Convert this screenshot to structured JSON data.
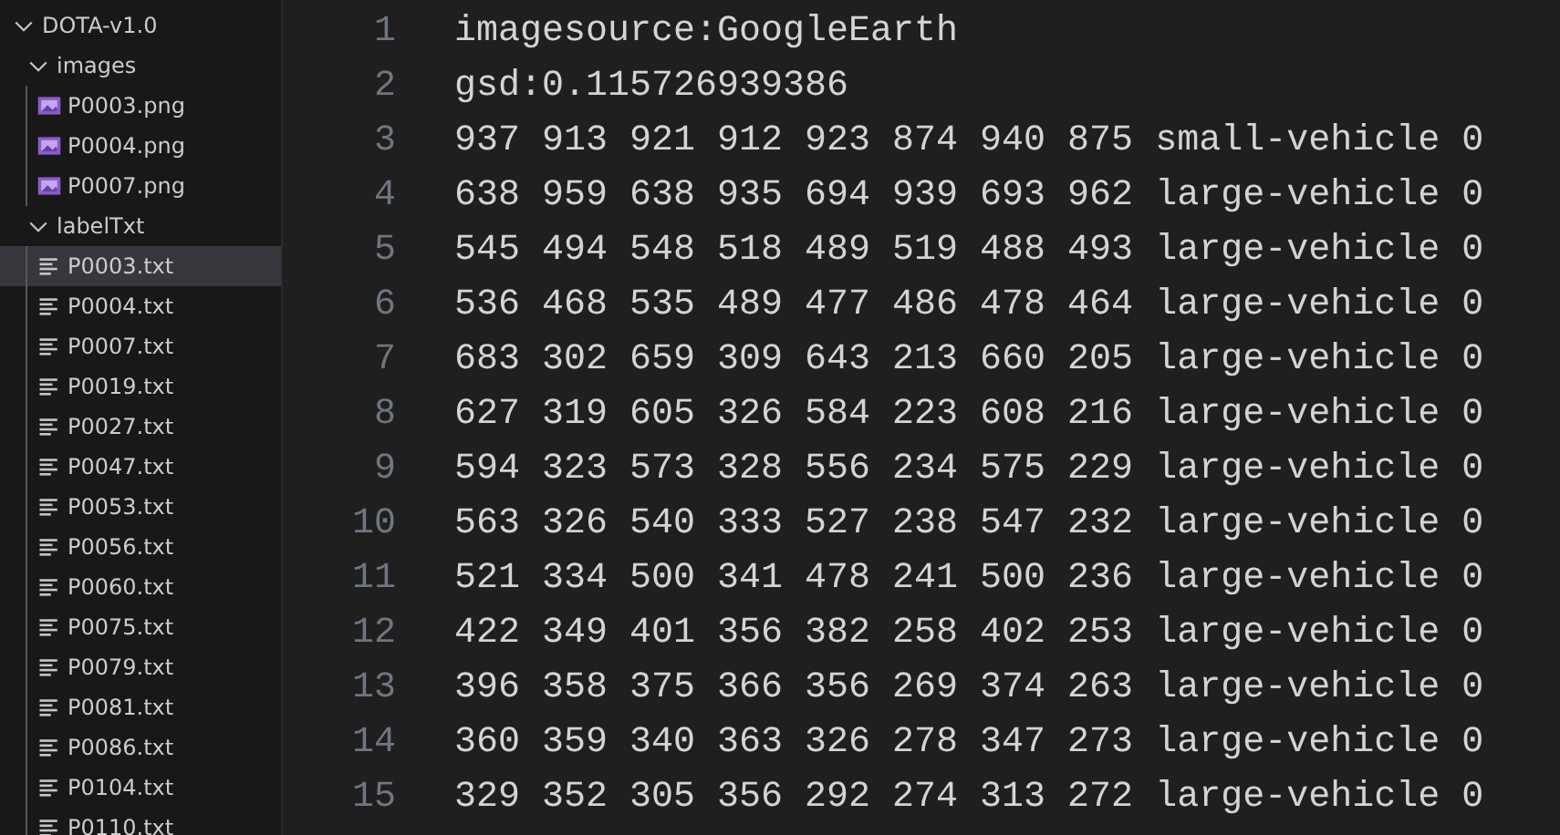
{
  "explorer": {
    "items": [
      {
        "label": "DOTA-v1.0",
        "kind": "folder",
        "expanded": true,
        "selected": false,
        "children": [
          {
            "label": "images",
            "kind": "folder",
            "expanded": true,
            "selected": false,
            "children": [
              {
                "label": "P0003.png",
                "kind": "image",
                "selected": false
              },
              {
                "label": "P0004.png",
                "kind": "image",
                "selected": false
              },
              {
                "label": "P0007.png",
                "kind": "image",
                "selected": false
              }
            ]
          },
          {
            "label": "labelTxt",
            "kind": "folder",
            "expanded": true,
            "selected": false,
            "children": [
              {
                "label": "P0003.txt",
                "kind": "text",
                "selected": true
              },
              {
                "label": "P0004.txt",
                "kind": "text",
                "selected": false
              },
              {
                "label": "P0007.txt",
                "kind": "text",
                "selected": false
              },
              {
                "label": "P0019.txt",
                "kind": "text",
                "selected": false
              },
              {
                "label": "P0027.txt",
                "kind": "text",
                "selected": false
              },
              {
                "label": "P0047.txt",
                "kind": "text",
                "selected": false
              },
              {
                "label": "P0053.txt",
                "kind": "text",
                "selected": false
              },
              {
                "label": "P0056.txt",
                "kind": "text",
                "selected": false
              },
              {
                "label": "P0060.txt",
                "kind": "text",
                "selected": false
              },
              {
                "label": "P0075.txt",
                "kind": "text",
                "selected": false
              },
              {
                "label": "P0079.txt",
                "kind": "text",
                "selected": false
              },
              {
                "label": "P0081.txt",
                "kind": "text",
                "selected": false
              },
              {
                "label": "P0086.txt",
                "kind": "text",
                "selected": false
              },
              {
                "label": "P0104.txt",
                "kind": "text",
                "selected": false
              },
              {
                "label": "P0110.txt",
                "kind": "text",
                "selected": false
              }
            ]
          }
        ]
      }
    ]
  },
  "editor": {
    "lines": [
      {
        "number": "1",
        "text": "imagesource:GoogleEarth"
      },
      {
        "number": "2",
        "text": "gsd:0.115726939386"
      },
      {
        "number": "3",
        "text": "937 913 921 912 923 874 940 875 small-vehicle 0"
      },
      {
        "number": "4",
        "text": "638 959 638 935 694 939 693 962 large-vehicle 0"
      },
      {
        "number": "5",
        "text": "545 494 548 518 489 519 488 493 large-vehicle 0"
      },
      {
        "number": "6",
        "text": "536 468 535 489 477 486 478 464 large-vehicle 0"
      },
      {
        "number": "7",
        "text": "683 302 659 309 643 213 660 205 large-vehicle 0"
      },
      {
        "number": "8",
        "text": "627 319 605 326 584 223 608 216 large-vehicle 0"
      },
      {
        "number": "9",
        "text": "594 323 573 328 556 234 575 229 large-vehicle 0"
      },
      {
        "number": "10",
        "text": "563 326 540 333 527 238 547 232 large-vehicle 0"
      },
      {
        "number": "11",
        "text": "521 334 500 341 478 241 500 236 large-vehicle 0"
      },
      {
        "number": "12",
        "text": "422 349 401 356 382 258 402 253 large-vehicle 0"
      },
      {
        "number": "13",
        "text": "396 358 375 366 356 269 374 263 large-vehicle 0"
      },
      {
        "number": "14",
        "text": "360 359 340 363 326 278 347 273 large-vehicle 0"
      },
      {
        "number": "15",
        "text": "329 352 305 356 292 274 313 272 large-vehicle 0"
      }
    ]
  }
}
